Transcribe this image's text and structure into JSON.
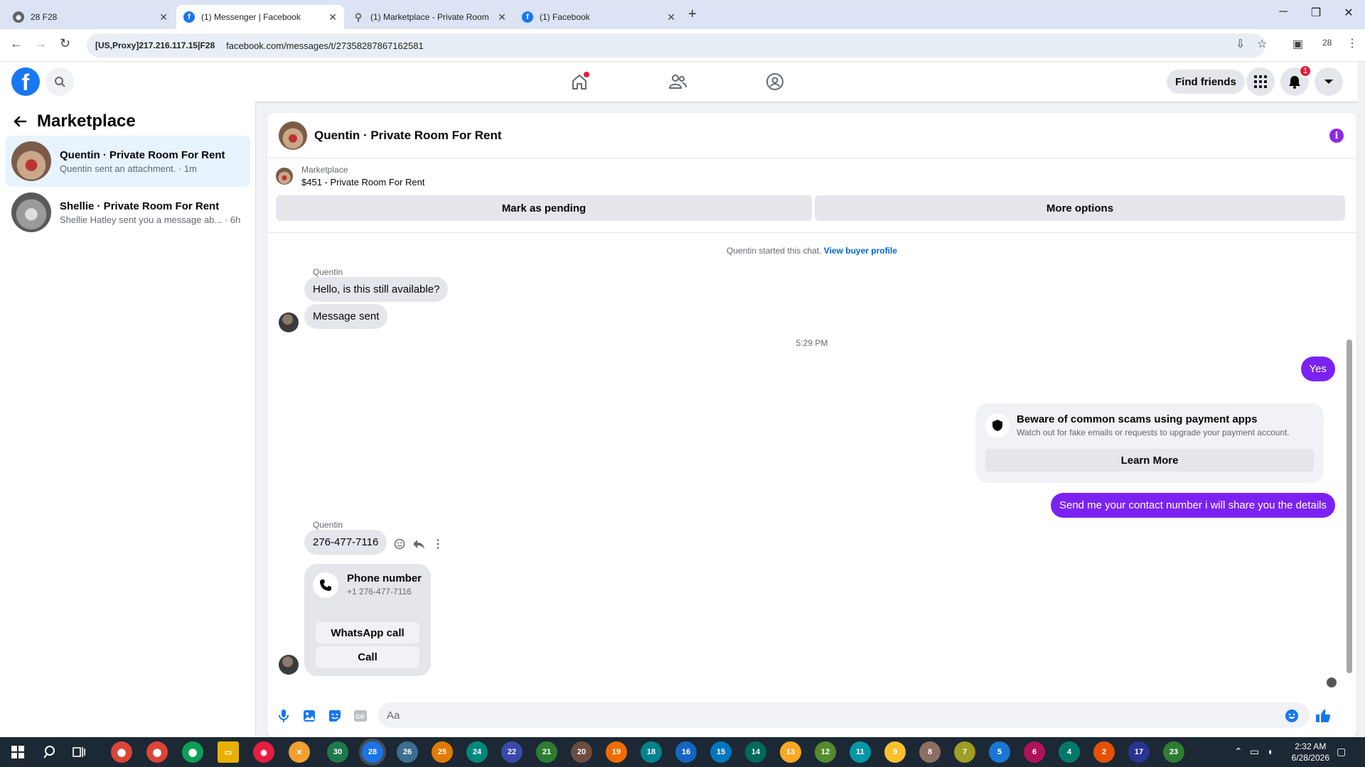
{
  "browser": {
    "tabs": [
      {
        "title": "28 F28",
        "icon": "globe-icon"
      },
      {
        "title": "(1) Messenger | Facebook",
        "icon": "facebook-icon",
        "active": true
      },
      {
        "title": "(1) Marketplace - Private Room",
        "icon": "link-icon"
      },
      {
        "title": "(1) Facebook",
        "icon": "facebook-icon"
      }
    ],
    "site_info": "[US,Proxy]217.216.117.15|F28",
    "url": "facebook.com/messages/t/27358287867162581",
    "profile_count": "28"
  },
  "header": {
    "logo": "f",
    "find_friends": "Find friends",
    "notification_count": "1",
    "accent": "#1877f2"
  },
  "sidebar": {
    "title": "Marketplace",
    "conversations": [
      {
        "title": "Quentin · Private Room For Rent",
        "preview": "Quentin sent an attachment.",
        "time": "· 1m"
      },
      {
        "title": "Shellie · Private Room For Rent",
        "preview": "Shellie Hatley sent you a message ab...",
        "time": "· 6h"
      }
    ]
  },
  "chat": {
    "title": "Quentin · Private Room For Rent",
    "listing_label": "Marketplace",
    "listing_title": "$451 - Private Room For Rent",
    "mark_pending": "Mark as pending",
    "more_options": "More options",
    "started_text": "Quentin started this chat.",
    "view_profile": "View buyer profile",
    "sender_1": "Quentin",
    "msg_1": "Hello, is this still available?",
    "msg_2": "Message sent",
    "timestamp": "5:29 PM",
    "out_1": "Yes",
    "scam_title": "Beware of common scams using payment apps",
    "scam_sub": "Watch out for fake emails or requests to upgrade your payment account.",
    "learn_more": "Learn More",
    "out_2": "Send me your contact number i will share you the details",
    "sender_2": "Quentin",
    "msg_3": "276-477-7116",
    "phone_title": "Phone number",
    "phone_number": "+1 276-477-7116",
    "whatsapp": "WhatsApp call",
    "call": "Call",
    "composer_placeholder": "Aa",
    "outgoing_color": "#7b22f3"
  },
  "taskbar": {
    "numbers": [
      "30",
      "28",
      "26",
      "25",
      "24",
      "22",
      "21",
      "20",
      "19",
      "18",
      "16",
      "15",
      "14",
      "13",
      "12",
      "11",
      "9",
      "8",
      "7",
      "5",
      "6",
      "4",
      "2",
      "17",
      "23"
    ],
    "time": "2:32 AM",
    "date": "6/28/2026"
  }
}
